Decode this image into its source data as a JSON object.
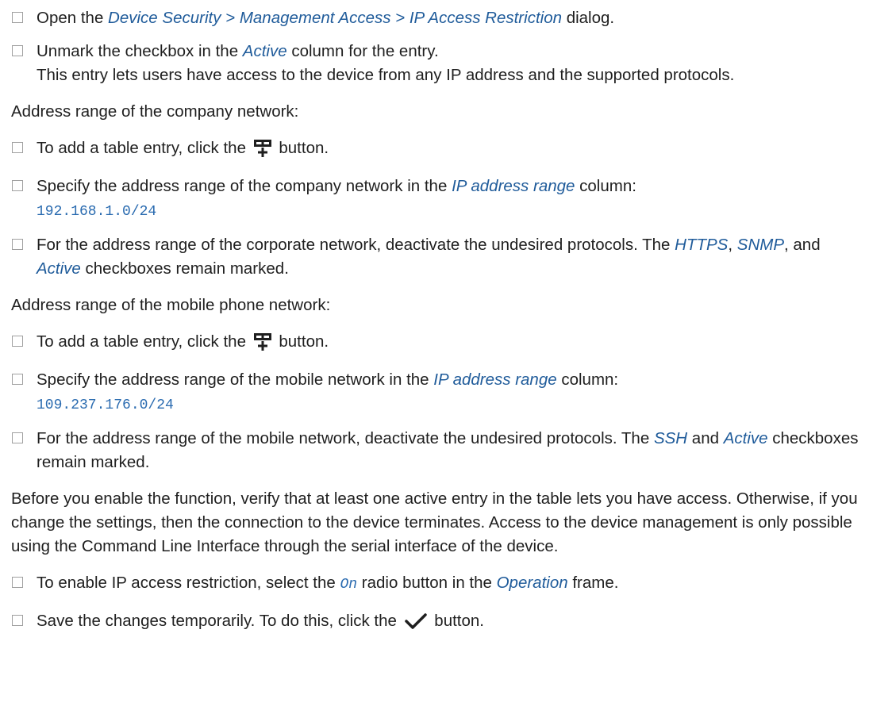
{
  "steps": {
    "s1": {
      "pre": "Open the ",
      "ref": "Device Security > Management Access > IP Access Restriction",
      "post": " dialog."
    },
    "s2": {
      "pre": "Unmark the checkbox in the ",
      "ref": "Active",
      "post": " column for the entry.",
      "line2": "This entry lets users have access to the device from any IP address and the supported protocols."
    },
    "company_heading": "Address range of the company network:",
    "s3": {
      "pre": "To add a table entry, click the ",
      "post": " button.",
      "icon": "add-table-entry-icon"
    },
    "s4": {
      "pre": "Specify the address range of the company network in the ",
      "ref": "IP address range",
      "post": " column:",
      "value": "192.168.1.0/24"
    },
    "s5": {
      "pre": "For the address range of the corporate network, deactivate the undesired protocols. The ",
      "ref1": "HTTPS",
      "sep1": ", ",
      "ref2": "SNMP",
      "sep2": ", and ",
      "ref3": "Active",
      "post": " checkboxes remain marked."
    },
    "mobile_heading": "Address range of the mobile phone network:",
    "s6": {
      "pre": "To add a table entry, click the ",
      "post": " button.",
      "icon": "add-table-entry-icon"
    },
    "s7": {
      "pre": "Specify the address range of the mobile network in the ",
      "ref": "IP address range",
      "post": " column:",
      "value": "109.237.176.0/24"
    },
    "s8": {
      "pre": "For the address range of the mobile network, deactivate the undesired protocols. The ",
      "ref1": "SSH",
      "mid": " and ",
      "ref2": "Active",
      "post": " checkboxes remain marked."
    },
    "warning": "Before you enable the function, verify that at least one active entry in the table lets you have access. Otherwise, if you change the settings, then the connection to the device terminates. Access to the device management is only possible using the Command Line Interface through the serial interface of the device.",
    "s9": {
      "pre": "To enable IP access restriction, select the ",
      "code": "On",
      "mid": " radio button in the ",
      "ref": "Operation",
      "post": " frame."
    },
    "s10": {
      "pre": "Save the changes temporarily. To do this, click the ",
      "post": " button.",
      "icon": "checkmark-icon"
    }
  },
  "colors": {
    "link": "#1f5b9a",
    "code": "#2a6bb0",
    "checkbox_border": "#a0a0a0"
  }
}
